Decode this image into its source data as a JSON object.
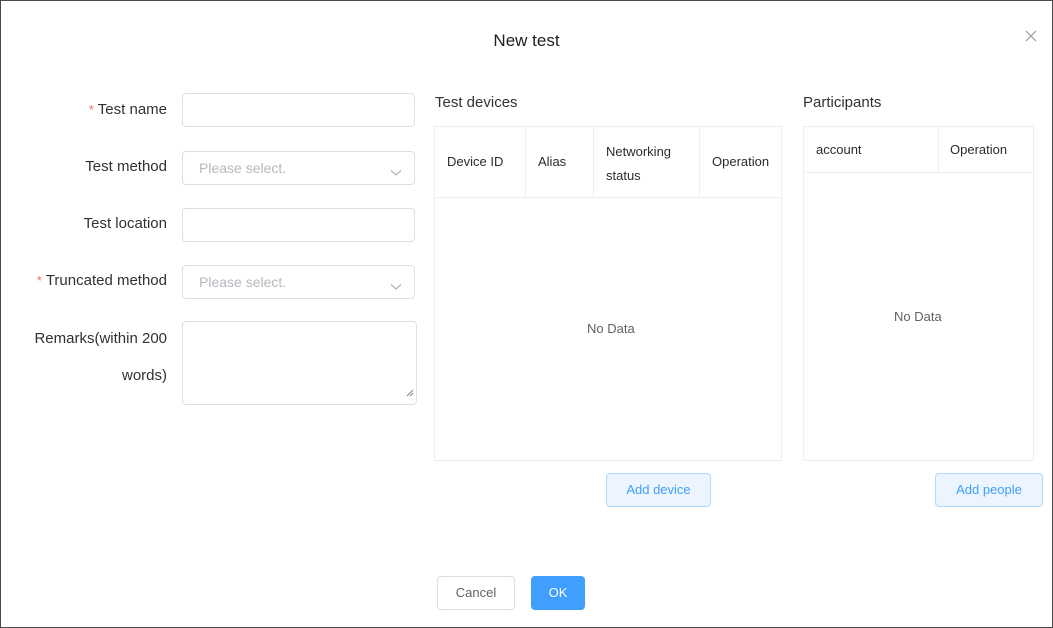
{
  "dialog": {
    "title": "New test",
    "close_icon": "close-icon"
  },
  "form": {
    "test_name_label": "Test name",
    "test_method_label": "Test method",
    "test_method_placeholder": "Please select.",
    "test_location_label": "Test location",
    "truncated_method_label": "Truncated method",
    "truncated_method_placeholder": "Please select.",
    "remarks_label_line1": "Remarks(within 200",
    "remarks_label_line2": "words)",
    "required_mark": "*",
    "test_name_value": "",
    "test_location_value": "",
    "remarks_value": ""
  },
  "devices": {
    "title": "Test devices",
    "columns": [
      "Device ID",
      "Alias",
      "Networking status",
      "Operation"
    ],
    "networking_line1": "Networking",
    "networking_line2": "status",
    "empty_text": "No Data",
    "add_button": "Add device"
  },
  "participants": {
    "title": "Participants",
    "columns": [
      "account",
      "Operation"
    ],
    "empty_text": "No Data",
    "add_button": "Add people"
  },
  "footer": {
    "cancel": "Cancel",
    "ok": "OK"
  },
  "colors": {
    "primary": "#409eff",
    "required": "#f56c6c",
    "border": "#dcdfe6"
  }
}
